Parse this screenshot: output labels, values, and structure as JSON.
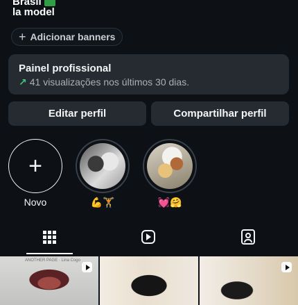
{
  "profile": {
    "bio_top": "Brasil",
    "bio_line": "la model"
  },
  "banners": {
    "label": "Adicionar banners"
  },
  "dashboard": {
    "title": "Painel profissional",
    "stats": "41 visualizações nos últimos 30 dias."
  },
  "actions": {
    "edit": "Editar perfil",
    "share": "Compartilhar perfil"
  },
  "highlights": {
    "new_label": "Novo",
    "items": [
      {
        "label": "💪🏋"
      },
      {
        "label": "💓🤗"
      }
    ]
  },
  "tabs": [
    {
      "name": "grid",
      "icon": "grid-icon",
      "active": true
    },
    {
      "name": "reels",
      "icon": "reels-icon"
    },
    {
      "name": "tagged",
      "icon": "tagged-icon"
    }
  ],
  "posts": [
    {
      "type": "reel",
      "watermark": "ANOTHER PAGE · Lina Cogo"
    },
    {
      "type": "photo"
    },
    {
      "type": "reel"
    }
  ],
  "colors": {
    "background": "#0d1115",
    "card": "#252b31",
    "text": "#f3f5f7",
    "muted": "#a8b0b8",
    "accent_green": "#46c37b"
  }
}
